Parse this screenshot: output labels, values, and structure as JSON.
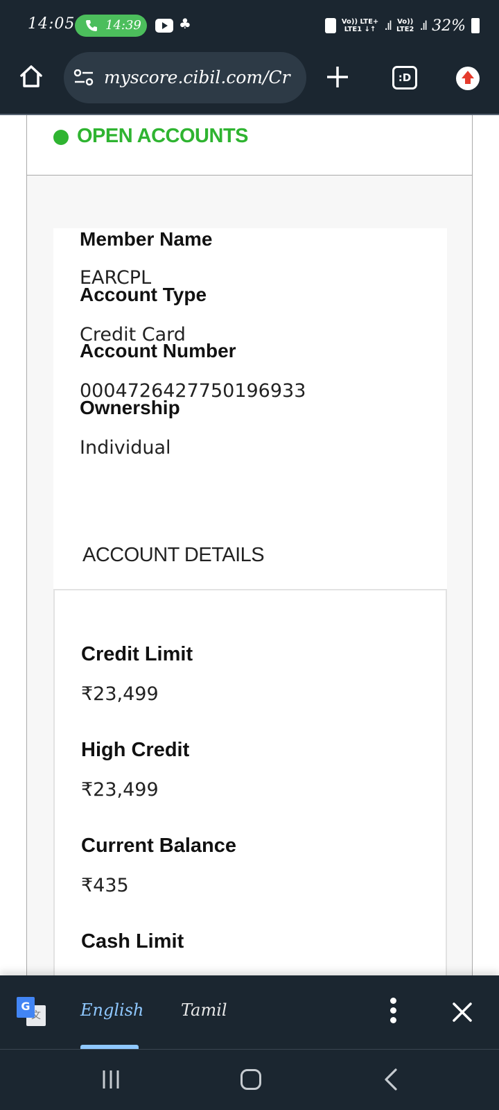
{
  "status_bar": {
    "time": "14:05",
    "call_time": "14:39",
    "net1": "Vo)) LTE+",
    "net1_sub": "LTE1 ↓↑",
    "net2": "Vo))",
    "net2_sub": "LTE2",
    "battery": "32%"
  },
  "browser": {
    "url": "myscore.cibil.com/Cr",
    "tabs_label": ":D"
  },
  "page": {
    "section_header": "OPEN ACCOUNTS",
    "fields": [
      {
        "label": "Member Name",
        "value": "EARCPL"
      },
      {
        "label": "Account Type",
        "value": "Credit Card"
      },
      {
        "label": "Account Number",
        "value": "0004726427750196933"
      },
      {
        "label": "Ownership",
        "value": "Individual"
      }
    ],
    "details_title": "ACCOUNT DETAILS",
    "details": [
      {
        "label": "Credit Limit",
        "value": "₹23,499"
      },
      {
        "label": "High Credit",
        "value": "₹23,499"
      },
      {
        "label": "Current Balance",
        "value": "₹435"
      },
      {
        "label": "Cash Limit",
        "value": ""
      }
    ]
  },
  "translate_bar": {
    "lang_active": "English",
    "lang_other": "Tamil"
  },
  "colors": {
    "accent_green": "#2fb431",
    "chrome_dark": "#1b2630",
    "active_lang": "#8fc8ff"
  }
}
